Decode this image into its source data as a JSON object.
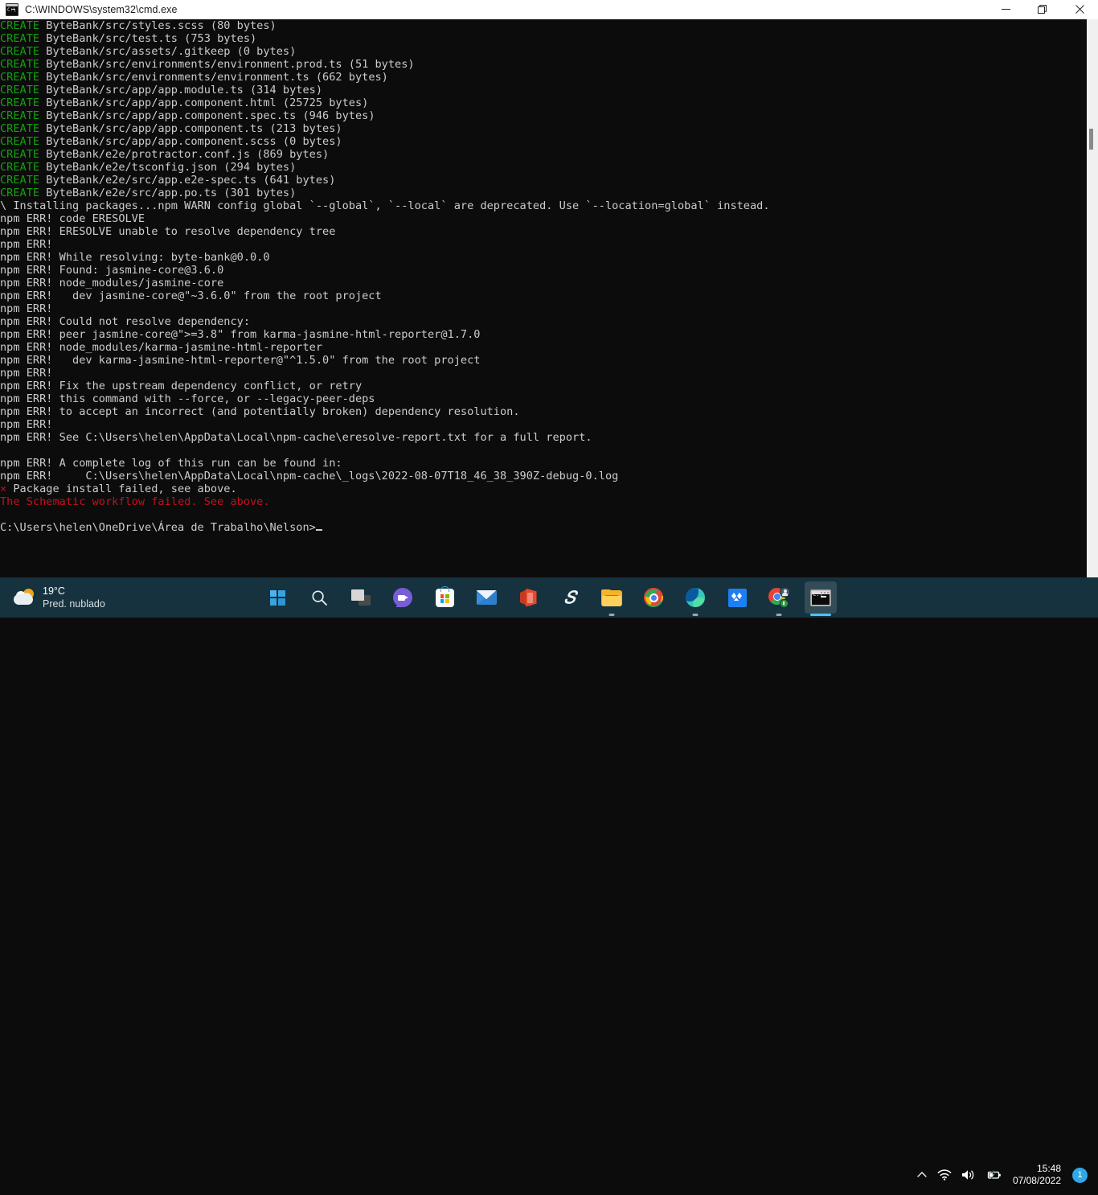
{
  "window": {
    "title": "C:\\WINDOWS\\system32\\cmd.exe",
    "icon": "cmd-icon",
    "minimize_label": "Minimize",
    "maximize_label": "Restore",
    "close_label": "Close"
  },
  "console": {
    "prompt": "C:\\Users\\helen\\OneDrive\\Área de Trabalho\\Nelson>",
    "lines": [
      {
        "segments": [
          {
            "text": "CREATE",
            "color": "green"
          },
          {
            "text": " ByteBank/src/styles.scss (80 bytes)",
            "color": "white"
          }
        ]
      },
      {
        "segments": [
          {
            "text": "CREATE",
            "color": "green"
          },
          {
            "text": " ByteBank/src/test.ts (753 bytes)",
            "color": "white"
          }
        ]
      },
      {
        "segments": [
          {
            "text": "CREATE",
            "color": "green"
          },
          {
            "text": " ByteBank/src/assets/.gitkeep (0 bytes)",
            "color": "white"
          }
        ]
      },
      {
        "segments": [
          {
            "text": "CREATE",
            "color": "green"
          },
          {
            "text": " ByteBank/src/environments/environment.prod.ts (51 bytes)",
            "color": "white"
          }
        ]
      },
      {
        "segments": [
          {
            "text": "CREATE",
            "color": "green"
          },
          {
            "text": " ByteBank/src/environments/environment.ts (662 bytes)",
            "color": "white"
          }
        ]
      },
      {
        "segments": [
          {
            "text": "CREATE",
            "color": "green"
          },
          {
            "text": " ByteBank/src/app/app.module.ts (314 bytes)",
            "color": "white"
          }
        ]
      },
      {
        "segments": [
          {
            "text": "CREATE",
            "color": "green"
          },
          {
            "text": " ByteBank/src/app/app.component.html (25725 bytes)",
            "color": "white"
          }
        ]
      },
      {
        "segments": [
          {
            "text": "CREATE",
            "color": "green"
          },
          {
            "text": " ByteBank/src/app/app.component.spec.ts (946 bytes)",
            "color": "white"
          }
        ]
      },
      {
        "segments": [
          {
            "text": "CREATE",
            "color": "green"
          },
          {
            "text": " ByteBank/src/app/app.component.ts (213 bytes)",
            "color": "white"
          }
        ]
      },
      {
        "segments": [
          {
            "text": "CREATE",
            "color": "green"
          },
          {
            "text": " ByteBank/src/app/app.component.scss (0 bytes)",
            "color": "white"
          }
        ]
      },
      {
        "segments": [
          {
            "text": "CREATE",
            "color": "green"
          },
          {
            "text": " ByteBank/e2e/protractor.conf.js (869 bytes)",
            "color": "white"
          }
        ]
      },
      {
        "segments": [
          {
            "text": "CREATE",
            "color": "green"
          },
          {
            "text": " ByteBank/e2e/tsconfig.json (294 bytes)",
            "color": "white"
          }
        ]
      },
      {
        "segments": [
          {
            "text": "CREATE",
            "color": "green"
          },
          {
            "text": " ByteBank/e2e/src/app.e2e-spec.ts (641 bytes)",
            "color": "white"
          }
        ]
      },
      {
        "segments": [
          {
            "text": "CREATE",
            "color": "green"
          },
          {
            "text": " ByteBank/e2e/src/app.po.ts (301 bytes)",
            "color": "white"
          }
        ]
      },
      {
        "segments": [
          {
            "text": "\\ Installing packages...npm WARN config global `--global`, `--local` are deprecated. Use `--location=global` instead.",
            "color": "white"
          }
        ]
      },
      {
        "segments": [
          {
            "text": "npm ERR! code ERESOLVE",
            "color": "white"
          }
        ]
      },
      {
        "segments": [
          {
            "text": "npm ERR! ERESOLVE unable to resolve dependency tree",
            "color": "white"
          }
        ]
      },
      {
        "segments": [
          {
            "text": "npm ERR! ",
            "color": "white"
          }
        ]
      },
      {
        "segments": [
          {
            "text": "npm ERR! While resolving: byte-bank@0.0.0",
            "color": "white"
          }
        ]
      },
      {
        "segments": [
          {
            "text": "npm ERR! Found: jasmine-core@3.6.0",
            "color": "white"
          }
        ]
      },
      {
        "segments": [
          {
            "text": "npm ERR! node_modules/jasmine-core",
            "color": "white"
          }
        ]
      },
      {
        "segments": [
          {
            "text": "npm ERR!   dev jasmine-core@\"~3.6.0\" from the root project",
            "color": "white"
          }
        ]
      },
      {
        "segments": [
          {
            "text": "npm ERR! ",
            "color": "white"
          }
        ]
      },
      {
        "segments": [
          {
            "text": "npm ERR! Could not resolve dependency:",
            "color": "white"
          }
        ]
      },
      {
        "segments": [
          {
            "text": "npm ERR! peer jasmine-core@\">=3.8\" from karma-jasmine-html-reporter@1.7.0",
            "color": "white"
          }
        ]
      },
      {
        "segments": [
          {
            "text": "npm ERR! node_modules/karma-jasmine-html-reporter",
            "color": "white"
          }
        ]
      },
      {
        "segments": [
          {
            "text": "npm ERR!   dev karma-jasmine-html-reporter@\"^1.5.0\" from the root project",
            "color": "white"
          }
        ]
      },
      {
        "segments": [
          {
            "text": "npm ERR! ",
            "color": "white"
          }
        ]
      },
      {
        "segments": [
          {
            "text": "npm ERR! Fix the upstream dependency conflict, or retry",
            "color": "white"
          }
        ]
      },
      {
        "segments": [
          {
            "text": "npm ERR! this command with --force, or --legacy-peer-deps",
            "color": "white"
          }
        ]
      },
      {
        "segments": [
          {
            "text": "npm ERR! to accept an incorrect (and potentially broken) dependency resolution.",
            "color": "white"
          }
        ]
      },
      {
        "segments": [
          {
            "text": "npm ERR! ",
            "color": "white"
          }
        ]
      },
      {
        "segments": [
          {
            "text": "npm ERR! See C:\\Users\\helen\\AppData\\Local\\npm-cache\\eresolve-report.txt for a full report.",
            "color": "white"
          }
        ]
      },
      {
        "segments": [
          {
            "text": "",
            "color": "white"
          }
        ]
      },
      {
        "segments": [
          {
            "text": "npm ERR! A complete log of this run can be found in:",
            "color": "white"
          }
        ]
      },
      {
        "segments": [
          {
            "text": "npm ERR!     C:\\Users\\helen\\AppData\\Local\\npm-cache\\_logs\\2022-08-07T18_46_38_390Z-debug-0.log",
            "color": "white"
          }
        ]
      },
      {
        "segments": [
          {
            "text": "×",
            "color": "red"
          },
          {
            "text": " Package install failed, see above.",
            "color": "white"
          }
        ]
      },
      {
        "segments": [
          {
            "text": "The Schematic workflow failed. See above.",
            "color": "red"
          }
        ]
      },
      {
        "segments": [
          {
            "text": "",
            "color": "white"
          }
        ]
      }
    ],
    "colors": {
      "green": "#13a10e",
      "white": "#cccccc",
      "red": "#c50f1f",
      "background": "#0c0c0c"
    }
  },
  "taskbar": {
    "weather": {
      "temperature": "19°C",
      "condition": "Pred. nublado",
      "icon": "partly-cloudy-icon"
    },
    "items": [
      {
        "name": "start-button",
        "label": "Start",
        "icon": "windows-logo-icon",
        "active": false,
        "running": false
      },
      {
        "name": "search-button",
        "label": "Search",
        "icon": "search-icon",
        "active": false,
        "running": false
      },
      {
        "name": "task-view-button",
        "label": "Task View",
        "icon": "task-view-icon",
        "active": false,
        "running": false
      },
      {
        "name": "chat-button",
        "label": "Chat",
        "icon": "teams-chat-icon",
        "active": false,
        "running": false
      },
      {
        "name": "microsoft-store-button",
        "label": "Microsoft Store",
        "icon": "microsoft-store-icon",
        "active": false,
        "running": false
      },
      {
        "name": "mail-button",
        "label": "Mail",
        "icon": "mail-icon",
        "active": false,
        "running": false
      },
      {
        "name": "office-button",
        "label": "Office",
        "icon": "office-icon",
        "active": false,
        "running": false
      },
      {
        "name": "lightning-app-button",
        "label": "S",
        "icon": "lightning-s-icon",
        "active": false,
        "running": false
      },
      {
        "name": "file-explorer-button",
        "label": "File Explorer",
        "icon": "folder-icon",
        "active": false,
        "running": true
      },
      {
        "name": "chrome-button",
        "label": "Google Chrome",
        "icon": "chrome-icon",
        "active": false,
        "running": false
      },
      {
        "name": "edge-button",
        "label": "Microsoft Edge",
        "icon": "edge-icon",
        "active": false,
        "running": true
      },
      {
        "name": "dropbox-button",
        "label": "Dropbox",
        "icon": "dropbox-icon",
        "active": false,
        "running": false
      },
      {
        "name": "chrome-profile-button",
        "label": "Google Chrome",
        "icon": "chrome-profile-icon",
        "active": false,
        "running": true
      },
      {
        "name": "cmd-button",
        "label": "C:\\WINDOWS\\system32\\cmd.exe",
        "icon": "cmd-icon",
        "active": true,
        "running": true
      }
    ],
    "tray": {
      "overflow_label": "Show hidden icons",
      "wifi_label": "Network",
      "volume_label": "Volume",
      "battery_label": "Battery charging",
      "time": "15:48",
      "date": "07/08/2022",
      "notification_count": "1"
    },
    "colors": {
      "background": "#15323e",
      "accent": "#4cc2ff",
      "badge": "#2fa8e8"
    }
  }
}
